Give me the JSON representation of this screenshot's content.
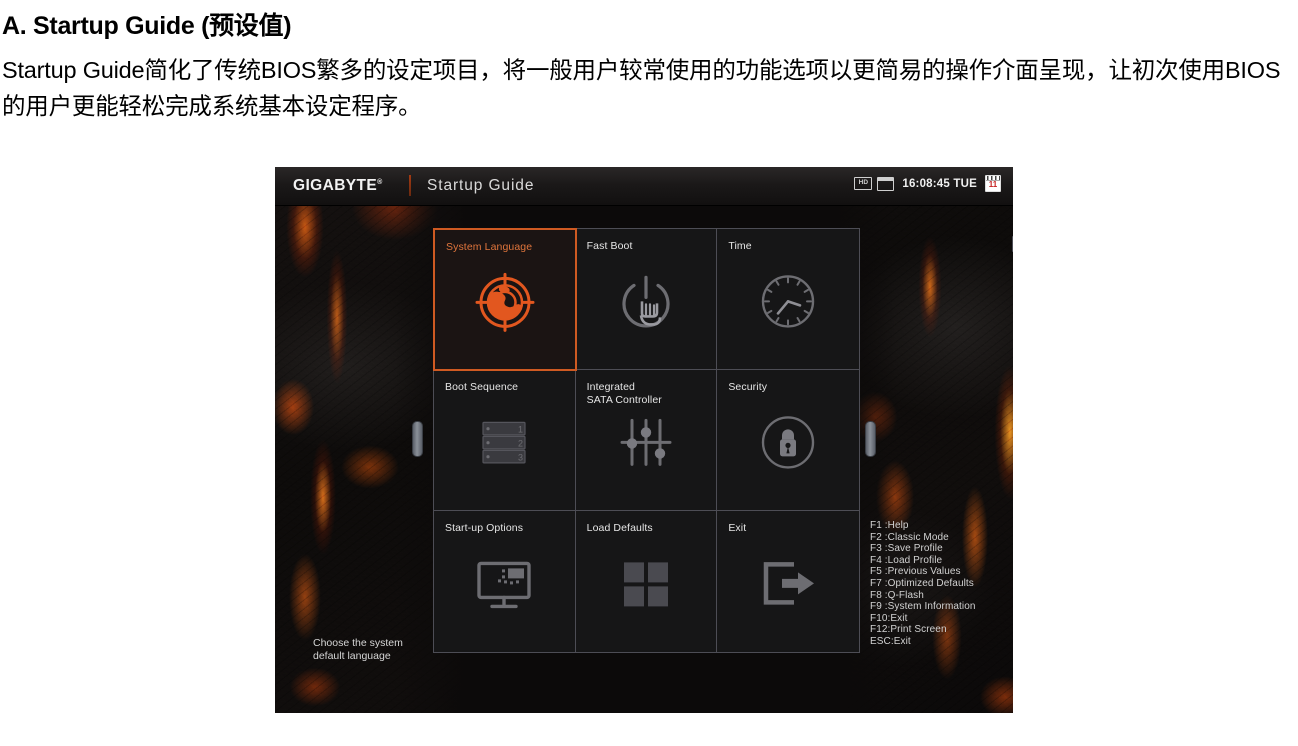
{
  "document": {
    "heading": "A. Startup Guide (预设值)",
    "body": "Startup Guide简化了传统BIOS繁多的设定项目，将一般用户较常使用的功能选项以更简易的操作介面呈现，让初次使用BIOS的用户更能轻松完成系统基本设定程序。"
  },
  "bios": {
    "header": {
      "brand": "GIGABYTE",
      "brand_trademark": "®",
      "app_title": "Startup Guide",
      "status": {
        "hd_label": "HD",
        "time": "16:08:45 TUE",
        "calendar_day": "11"
      }
    },
    "tiles": [
      {
        "label": "System Language",
        "icon": "globe-radar-icon",
        "selected": true
      },
      {
        "label": "Fast Boot",
        "icon": "power-hand-icon",
        "selected": false
      },
      {
        "label": "Time",
        "icon": "clock-icon",
        "selected": false
      },
      {
        "label": "Boot Sequence",
        "icon": "drive-stack-icon",
        "selected": false
      },
      {
        "label": "Integrated\nSATA Controller",
        "icon": "sliders-icon",
        "selected": false
      },
      {
        "label": "Security",
        "icon": "padlock-circle-icon",
        "selected": false
      },
      {
        "label": "Start-up Options",
        "icon": "monitor-icon",
        "selected": false
      },
      {
        "label": "Load Defaults",
        "icon": "four-squares-icon",
        "selected": false
      },
      {
        "label": "Exit",
        "icon": "exit-arrow-icon",
        "selected": false
      }
    ],
    "hotkeys": "F1 :Help\nF2 :Classic Mode\nF3 :Save Profile\nF4 :Load Profile\nF5 :Previous Values\nF7 :Optimized Defaults\nF8 :Q-Flash\nF9 :System Information\nF10:Exit\nF12:Print Screen\nESC:Exit",
    "help_text": "Choose the system\ndefault language",
    "colors": {
      "accent_orange": "#cf5a22",
      "selected_label": "#e0753c",
      "tile_border": "#4d4d55",
      "background": "#100d0c"
    }
  }
}
